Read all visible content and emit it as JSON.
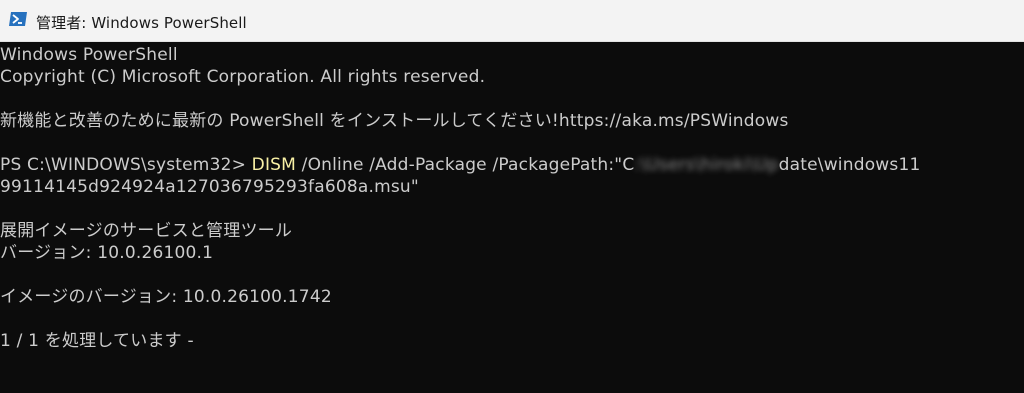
{
  "window": {
    "title": "管理者: Windows PowerShell",
    "icon": "powershell-icon",
    "titlebar_color": "#f3f3f3",
    "console_bg": "#0c0c0c",
    "text_color": "#cccccc",
    "command_color": "#f9f1a5"
  },
  "console": {
    "banner_line1": "Windows PowerShell",
    "banner_line2": "Copyright (C) Microsoft Corporation. All rights reserved.",
    "update_notice": "新機能と改善のために最新の PowerShell をインストールしてください!https://aka.ms/PSWindows",
    "prompt": "PS C:\\WINDOWS\\system32> ",
    "command_name": "DISM",
    "command_args_before_blur": " /Online /Add-Package /PackagePath:\"C",
    "command_args_blurred": ":\\Users\\hiroki\\Up",
    "command_args_after_blur": "date\\windows11",
    "command_line2": "99114145d924924a127036795293fa608a.msu\"",
    "tool_name": "展開イメージのサービスと管理ツール",
    "tool_version": "バージョン: 10.0.26100.1",
    "image_version": "イメージのバージョン: 10.0.26100.1742",
    "progress_text": "1 / 1 を処理しています -"
  }
}
